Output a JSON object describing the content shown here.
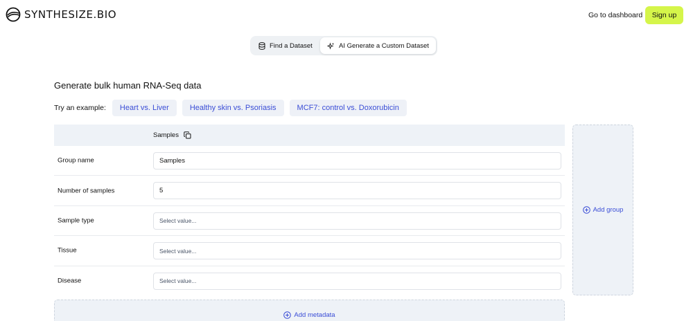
{
  "brand": {
    "name": "SYNTHESIZE.BIO"
  },
  "nav": {
    "dashboard": "Go to dashboard",
    "signup": "Sign up"
  },
  "mode_toggle": {
    "find": "Find a Dataset",
    "generate": "AI Generate a Custom Dataset",
    "active": "generate"
  },
  "heading": "Generate bulk human RNA-Seq data",
  "examples": {
    "label": "Try an example:",
    "items": [
      "Heart vs. Liver",
      "Healthy skin vs. Psoriasis",
      "MCF7: control vs. Doxorubicin"
    ]
  },
  "table": {
    "column_title": "Samples",
    "rows": [
      {
        "label": "Group name",
        "value": "Samples",
        "placeholder": false
      },
      {
        "label": "Number of samples",
        "value": "5",
        "placeholder": false
      },
      {
        "label": "Sample type",
        "value": "Select value...",
        "placeholder": true
      },
      {
        "label": "Tissue",
        "value": "Select value...",
        "placeholder": true
      },
      {
        "label": "Disease",
        "value": "Select value...",
        "placeholder": true
      }
    ]
  },
  "add_group": "Add group",
  "add_metadata": "Add metadata",
  "colors": {
    "accent": "#d5f54a",
    "link": "#3a4dd6",
    "panel": "#eef2f7"
  }
}
